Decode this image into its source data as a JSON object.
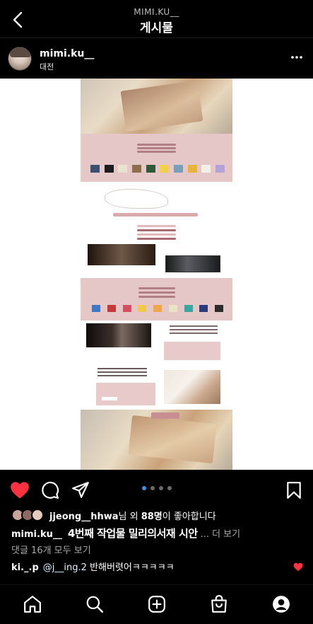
{
  "header": {
    "username": "MIMI.KU__",
    "title": "게시물"
  },
  "post": {
    "username": "mimi.ku__",
    "location": "대전",
    "carousel": {
      "count": 4,
      "active": 1
    }
  },
  "likes": {
    "first_liker": "jjeong__hhwa",
    "middle": "님 외 ",
    "count": "88명",
    "suffix": "이 좋아합니다"
  },
  "caption": {
    "username": "mimi.ku__",
    "text": "4번째 작업물 밀리의서재 시안",
    "more": "... 더 보기"
  },
  "comments": {
    "view_all": "댓글 16개 모두 보기",
    "items": [
      {
        "username": "ki._.p",
        "mention": "@j__ing.2",
        "text": " 반해버렷어ㅋㅋㅋㅋㅋ"
      }
    ]
  },
  "colors": {
    "like_red": "#ff3040",
    "active_dot": "#3797f0",
    "pink_panel": "#e6c7c7"
  },
  "icons": [
    "back-arrow-icon",
    "more-options-icon",
    "heart-icon",
    "comment-icon",
    "share-icon",
    "bookmark-icon",
    "home-icon",
    "search-icon",
    "create-icon",
    "shop-icon",
    "profile-icon"
  ]
}
